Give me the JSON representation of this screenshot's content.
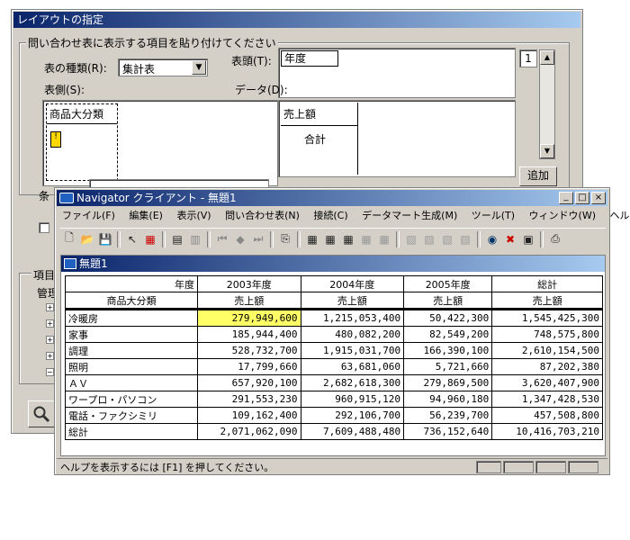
{
  "layout_dialog": {
    "title": "レイアウトの指定",
    "group_title": "問い合わせ表に表示する項目を貼り付けてください",
    "table_type_label": "表の種類(R):",
    "table_type_value": "集計表",
    "header_label": "表頭(T):",
    "header_item": "年度",
    "side_label": "表側(S):",
    "data_label": "データ(D):",
    "side_item": "商品大分類",
    "data_item": "売上額",
    "data_sub": "合計",
    "page_number": "1",
    "add_button": "追加",
    "condition_label": "条",
    "item_group_label": "項目",
    "manage_label": "管理"
  },
  "navigator": {
    "title": "Navigator クライアント - 無題1",
    "menu": [
      "ファイル(F)",
      "編集(E)",
      "表示(V)",
      "問い合わせ表(N)",
      "接続(C)",
      "データマート生成(M)",
      "ツール(T)",
      "ウィンドウ(W)",
      "ヘルプ(H)"
    ],
    "doc_title": "無題1",
    "status_text": "ヘルプを表示するには [F1] を押してください。",
    "grid": {
      "corner_top": "年度",
      "corner_bottom": "商品大分類",
      "years": [
        "2003年度",
        "2004年度",
        "2005年度",
        "総計"
      ],
      "measure": "売上額",
      "rows": [
        {
          "label": "冷暖房",
          "values": [
            "279,949,600",
            "1,215,053,400",
            "50,422,300",
            "1,545,425,300"
          ]
        },
        {
          "label": "家事",
          "values": [
            "185,944,400",
            "480,082,200",
            "82,549,200",
            "748,575,800"
          ]
        },
        {
          "label": "調理",
          "values": [
            "528,732,700",
            "1,915,031,700",
            "166,390,100",
            "2,610,154,500"
          ]
        },
        {
          "label": "照明",
          "values": [
            "17,799,660",
            "63,681,060",
            "5,721,660",
            "87,202,380"
          ]
        },
        {
          "label": "ＡＶ",
          "values": [
            "657,920,100",
            "2,682,618,300",
            "279,869,500",
            "3,620,407,900"
          ]
        },
        {
          "label": "ワープロ・パソコン",
          "values": [
            "291,553,230",
            "960,915,120",
            "94,960,180",
            "1,347,428,530"
          ]
        },
        {
          "label": "電話・ファクシミリ",
          "values": [
            "109,162,400",
            "292,106,700",
            "56,239,700",
            "457,508,800"
          ]
        },
        {
          "label": "総計",
          "values": [
            "2,071,062,090",
            "7,609,488,480",
            "736,152,640",
            "10,416,703,210"
          ]
        }
      ]
    }
  }
}
